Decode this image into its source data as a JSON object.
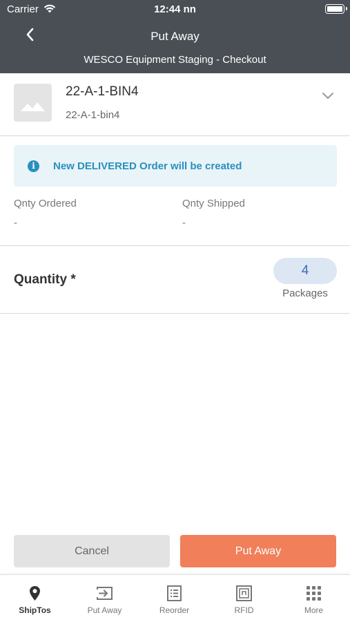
{
  "status_bar": {
    "carrier": "Carrier",
    "time": "12:44 nn"
  },
  "header": {
    "title": "Put Away",
    "subtitle": "WESCO Equipment Staging - Checkout"
  },
  "item": {
    "name": "22-A-1-BIN4",
    "code": "22-A-1-bin4"
  },
  "notice": {
    "text": "New DELIVERED Order will be created"
  },
  "fields": {
    "ordered": {
      "label": "Qnty Ordered",
      "value": "-"
    },
    "shipped": {
      "label": "Qnty Shipped",
      "value": "-"
    }
  },
  "quantity": {
    "label": "Quantity *",
    "value": "4",
    "unit": "Packages"
  },
  "actions": {
    "cancel_label": "Cancel",
    "primary_label": "Put Away"
  },
  "tabs": [
    {
      "label": "ShipTos",
      "icon": "location-pin-icon",
      "active": true
    },
    {
      "label": "Put Away",
      "icon": "put-away-icon",
      "active": false
    },
    {
      "label": "Reorder",
      "icon": "reorder-list-icon",
      "active": false
    },
    {
      "label": "RFID",
      "icon": "rfid-icon",
      "active": false
    },
    {
      "label": "More",
      "icon": "grid-dots-icon",
      "active": false
    }
  ],
  "colors": {
    "header_bg": "#4a4f55",
    "primary": "#f07f5a",
    "info": "#2a8fbd",
    "pill_bg": "#dde6f3",
    "pill_text": "#3d6fb6"
  }
}
